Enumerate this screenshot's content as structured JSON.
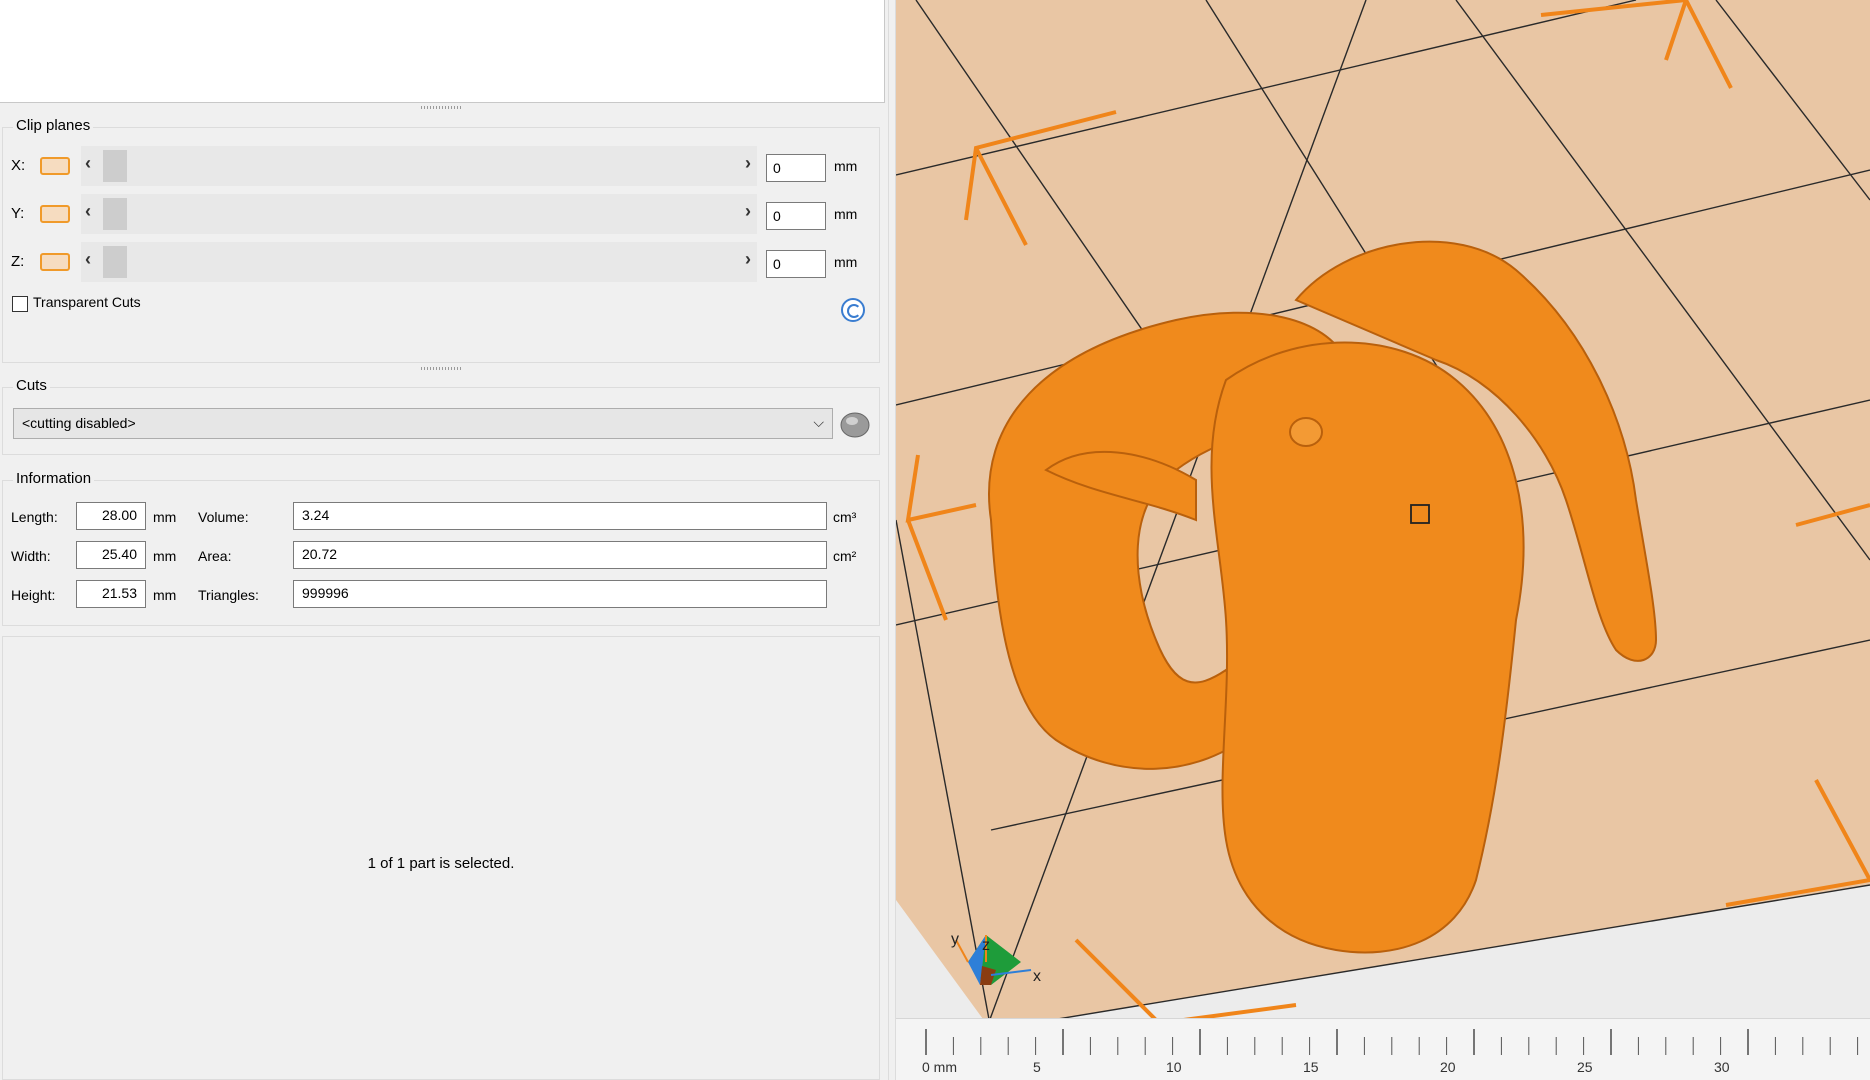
{
  "clip_planes": {
    "title": "Clip planes",
    "rows": [
      {
        "axis": "X:",
        "value": "0",
        "unit": "mm"
      },
      {
        "axis": "Y:",
        "value": "0",
        "unit": "mm"
      },
      {
        "axis": "Z:",
        "value": "0",
        "unit": "mm"
      }
    ],
    "transparent_cuts_label": "Transparent Cuts",
    "transparent_cuts_checked": false
  },
  "cuts": {
    "title": "Cuts",
    "selected": "<cutting disabled>"
  },
  "information": {
    "title": "Information",
    "length_label": "Length:",
    "length_value": "28.00",
    "length_unit": "mm",
    "width_label": "Width:",
    "width_value": "25.40",
    "width_unit": "mm",
    "height_label": "Height:",
    "height_value": "21.53",
    "height_unit": "mm",
    "volume_label": "Volume:",
    "volume_value": "3.24",
    "volume_unit": "cm³",
    "area_label": "Area:",
    "area_value": "20.72",
    "area_unit": "cm²",
    "triangles_label": "Triangles:",
    "triangles_value": "999996"
  },
  "status": {
    "selection_text": "1 of 1 part is selected."
  },
  "viewport": {
    "model_color": "#f08a1c",
    "bed_color": "#e9c6a4",
    "axis_labels": {
      "x": "x",
      "y": "y",
      "z": "z"
    },
    "ruler_labels": [
      "0 mm",
      "5",
      "10",
      "15",
      "20",
      "25",
      "30"
    ]
  }
}
